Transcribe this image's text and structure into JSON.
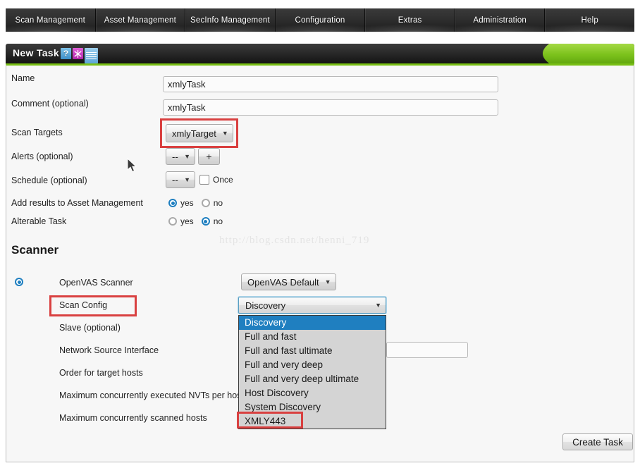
{
  "nav": {
    "tabs": [
      {
        "label": "Scan Management"
      },
      {
        "label": "Asset Management"
      },
      {
        "label": "SecInfo Management"
      },
      {
        "label": "Configuration"
      },
      {
        "label": "Extras"
      },
      {
        "label": "Administration"
      },
      {
        "label": "Help"
      }
    ]
  },
  "titlebar": {
    "title": "New Task",
    "icons": [
      {
        "name": "help-icon",
        "glyph": "?"
      },
      {
        "name": "new-icon",
        "glyph": "*"
      },
      {
        "name": "list-icon",
        "glyph": "≡"
      }
    ]
  },
  "form": {
    "name": {
      "label": "Name",
      "value": "xmlyTask"
    },
    "comment": {
      "label": "Comment (optional)",
      "value": "xmlyTask"
    },
    "scan_targets": {
      "label": "Scan Targets",
      "value": "xmlyTarget"
    },
    "alerts": {
      "label": "Alerts (optional)",
      "value": "--",
      "add_label": "+"
    },
    "schedule": {
      "label": "Schedule (optional)",
      "value": "--",
      "once_label": "Once"
    },
    "add_results": {
      "label": "Add results to Asset Management",
      "yes_label": "yes",
      "no_label": "no",
      "selected": "yes"
    },
    "alterable": {
      "label": "Alterable Task",
      "yes_label": "yes",
      "no_label": "no",
      "selected": "no"
    }
  },
  "scanner": {
    "heading": "Scanner",
    "openvas": {
      "label": "OpenVAS Scanner",
      "value": "OpenVAS Default"
    },
    "scan_config": {
      "label": "Scan Config",
      "value": "Discovery"
    },
    "slave": {
      "label": "Slave (optional)"
    },
    "network_source_interface": {
      "label": "Network Source Interface",
      "value": ""
    },
    "order_target_hosts": {
      "label": "Order for target hosts"
    },
    "max_nvts": {
      "label": "Maximum concurrently executed NVTs per host"
    },
    "max_hosts": {
      "label": "Maximum concurrently scanned hosts"
    },
    "scan_config_options": [
      {
        "label": "Discovery",
        "selected": true
      },
      {
        "label": "Full and fast",
        "selected": false
      },
      {
        "label": "Full and fast ultimate",
        "selected": false
      },
      {
        "label": "Full and very deep",
        "selected": false
      },
      {
        "label": "Full and very deep ultimate",
        "selected": false
      },
      {
        "label": "Host Discovery",
        "selected": false
      },
      {
        "label": "System Discovery",
        "selected": false
      },
      {
        "label": "XMLY443",
        "selected": false
      }
    ]
  },
  "actions": {
    "create_task": "Create Task"
  },
  "watermark": {
    "text": "http://blog.csdn.net/henni_719"
  },
  "colors": {
    "accent_green": "#78bf14",
    "highlight_blue": "#1f7fc0",
    "annotation_red": "#d94040"
  }
}
